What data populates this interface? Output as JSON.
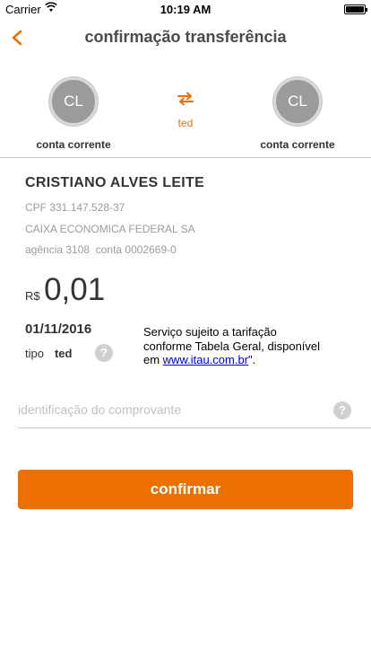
{
  "status_bar": {
    "carrier": "Carrier",
    "time": "10:19 AM",
    "battery_level": 1.0
  },
  "nav": {
    "title": "confirmação transferência"
  },
  "accounts": {
    "from": {
      "initials": "CL",
      "label": "conta corrente"
    },
    "to": {
      "initials": "CL",
      "label": "conta corrente"
    },
    "transfer_type": "ted"
  },
  "payee": {
    "name": "CRISTIANO ALVES LEITE",
    "cpf": "CPF 331.147.528-37",
    "bank": "CAIXA ECONOMICA FEDERAL SA",
    "agencia": "agência 3108  conta 0002669-0"
  },
  "amount": {
    "currency": "R$",
    "value": "0,01"
  },
  "date": "01/11/2016",
  "tipo": {
    "label": "tipo",
    "value": "ted"
  },
  "help_icon": "?",
  "notice": {
    "text_before": "Serviço sujeito a tarifação conforme Tabela Geral, disponível em ",
    "link": "www.itau.com.br",
    "text_after": "\"."
  },
  "identification": {
    "placeholder": "identificação do comprovante"
  },
  "confirm_label": "confirmar",
  "colors": {
    "accent": "#ec7000",
    "avatar": "#9b9b9b",
    "link": "#0000cc"
  }
}
